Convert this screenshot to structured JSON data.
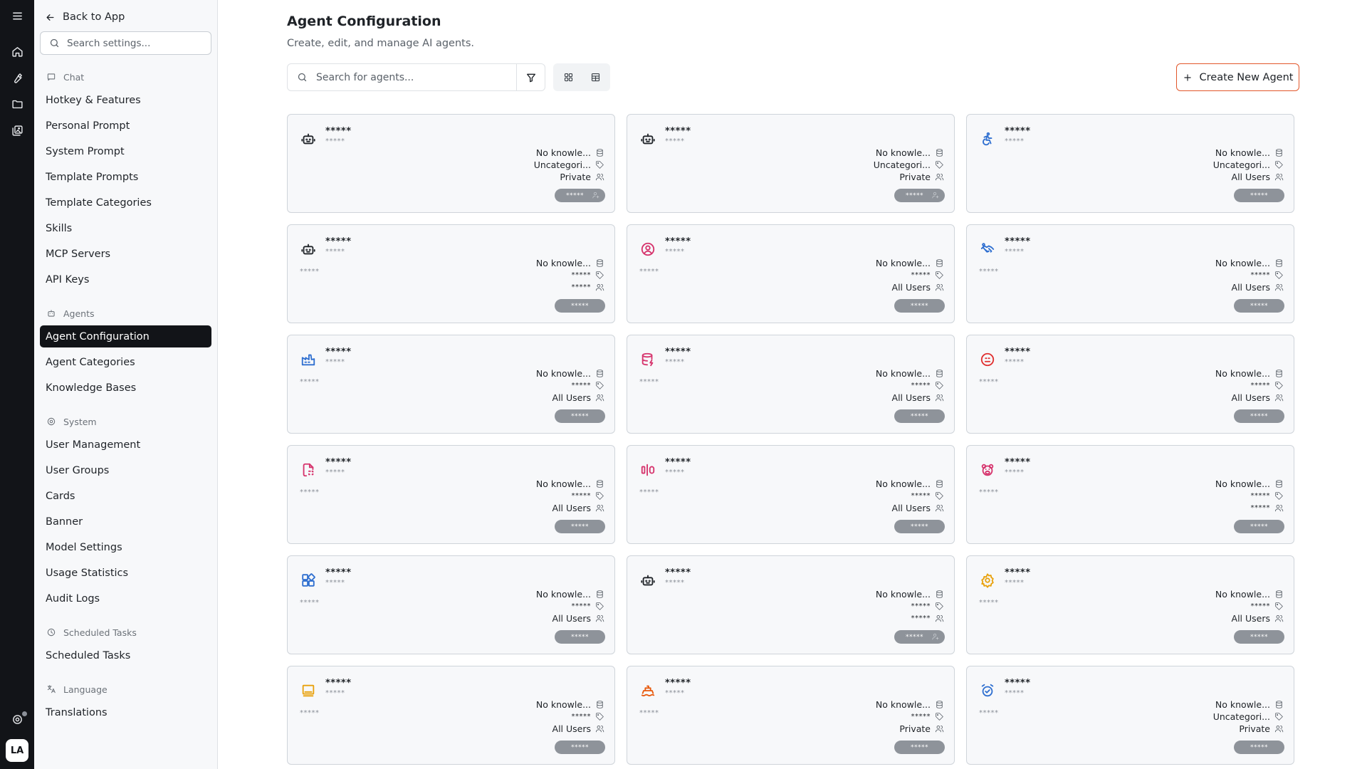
{
  "nav": {
    "back_label": "Back to App",
    "search_placeholder": "Search settings...",
    "sections": [
      {
        "title": "Chat",
        "icon": "chat-icon",
        "items": [
          "Hotkey & Features",
          "Personal Prompt",
          "System Prompt",
          "Template Prompts",
          "Template Categories",
          "Skills",
          "MCP Servers",
          "API Keys"
        ]
      },
      {
        "title": "Agents",
        "icon": "agents-icon",
        "items": [
          "Agent Configuration",
          "Agent Categories",
          "Knowledge Bases"
        ]
      },
      {
        "title": "System",
        "icon": "system-icon",
        "items": [
          "User Management",
          "User Groups",
          "Cards",
          "Banner",
          "Model Settings",
          "Usage Statistics",
          "Audit Logs"
        ]
      },
      {
        "title": "Scheduled Tasks",
        "icon": "clock-icon",
        "items": [
          "Scheduled Tasks"
        ]
      },
      {
        "title": "Language",
        "icon": "language-icon",
        "items": [
          "Translations"
        ]
      }
    ],
    "active_item": "Agent Configuration"
  },
  "rail": {
    "icons": [
      "menu-icon",
      "home-icon",
      "tool-icon",
      "folder-icon",
      "gallery-icon"
    ],
    "bottom_icon": "support-icon",
    "avatar_initials": "LA"
  },
  "header": {
    "title": "Agent Configuration",
    "subtitle": "Create, edit, and manage AI agents.",
    "search_placeholder": "Search for agents...",
    "create_label": "Create New Agent"
  },
  "colors": {
    "accent": "#e2572b",
    "active_nav": "#121418",
    "pill": "#8e939a"
  },
  "cards": [
    {
      "icon": "robot-icon",
      "icon_color": "#1f2328",
      "name": "*****",
      "sub": "*****",
      "desc": "",
      "knowledge": "No knowle...",
      "category": "Uncategori...",
      "access": "Private",
      "badge": "*****",
      "badge_user_icon": true
    },
    {
      "icon": "robot-icon",
      "icon_color": "#1f2328",
      "name": "*****",
      "sub": "*****",
      "desc": "",
      "knowledge": "No knowle...",
      "category": "Uncategori...",
      "access": "Private",
      "badge": "*****",
      "badge_user_icon": true
    },
    {
      "icon": "accessibility-icon",
      "icon_color": "#2f6fd0",
      "name": "*****",
      "sub": "*****",
      "desc": "",
      "knowledge": "No knowle...",
      "category": "Uncategori...",
      "access": "All Users",
      "badge": "*****",
      "badge_user_icon": false
    },
    {
      "icon": "robot-icon",
      "icon_color": "#1f2328",
      "name": "*****",
      "sub": "*****",
      "desc": "*****",
      "knowledge": "No knowle...",
      "category": "*****",
      "access": "*****",
      "badge": "*****",
      "badge_user_icon": false
    },
    {
      "icon": "user-circle-icon",
      "icon_color": "#d6336c",
      "name": "*****",
      "sub": "*****",
      "desc": "*****",
      "knowledge": "No knowle...",
      "category": "*****",
      "access": "All Users",
      "badge": "*****",
      "badge_user_icon": false
    },
    {
      "icon": "handshake-icon",
      "icon_color": "#2f6fd0",
      "name": "*****",
      "sub": "*****",
      "desc": "*****",
      "knowledge": "No knowle...",
      "category": "*****",
      "access": "All Users",
      "badge": "*****",
      "badge_user_icon": false
    },
    {
      "icon": "factory-icon",
      "icon_color": "#2f6fd0",
      "name": "*****",
      "sub": "*****",
      "desc": "*****",
      "knowledge": "No knowle...",
      "category": "*****",
      "access": "All Users",
      "badge": "*****",
      "badge_user_icon": false
    },
    {
      "icon": "database-bolt-icon",
      "icon_color": "#d6336c",
      "name": "*****",
      "sub": "*****",
      "desc": "*****",
      "knowledge": "No knowle...",
      "category": "*****",
      "access": "All Users",
      "badge": "*****",
      "badge_user_icon": false
    },
    {
      "icon": "face-neutral-icon",
      "icon_color": "#e03131",
      "name": "*****",
      "sub": "*****",
      "desc": "*****",
      "knowledge": "No knowle...",
      "category": "*****",
      "access": "All Users",
      "badge": "*****",
      "badge_user_icon": false
    },
    {
      "icon": "file-dashed-icon",
      "icon_color": "#d6336c",
      "name": "*****",
      "sub": "*****",
      "desc": "*****",
      "knowledge": "No knowle...",
      "category": "*****",
      "access": "All Users",
      "badge": "*****",
      "badge_user_icon": false
    },
    {
      "icon": "align-center-icon",
      "icon_color": "#d6336c",
      "name": "*****",
      "sub": "*****",
      "desc": "*****",
      "knowledge": "No knowle...",
      "category": "*****",
      "access": "All Users",
      "badge": "*****",
      "badge_user_icon": false
    },
    {
      "icon": "bear-icon",
      "icon_color": "#d6336c",
      "name": "*****",
      "sub": "*****",
      "desc": "*****",
      "knowledge": "No knowle...",
      "category": "*****",
      "access": "*****",
      "badge": "*****",
      "badge_user_icon": false
    },
    {
      "icon": "apps-icon",
      "icon_color": "#2f6fd0",
      "name": "*****",
      "sub": "*****",
      "desc": "*****",
      "knowledge": "No knowle...",
      "category": "*****",
      "access": "All Users",
      "badge": "*****",
      "badge_user_icon": false
    },
    {
      "icon": "robot-icon",
      "icon_color": "#1f2328",
      "name": "*****",
      "sub": "*****",
      "desc": "",
      "knowledge": "No knowle...",
      "category": "*****",
      "access": "*****",
      "badge": "*****",
      "badge_user_icon": true
    },
    {
      "icon": "gear-icon",
      "icon_color": "#e8a10c",
      "name": "*****",
      "sub": "*****",
      "desc": "*****",
      "knowledge": "No knowle...",
      "category": "*****",
      "access": "All Users",
      "badge": "*****",
      "badge_user_icon": false
    },
    {
      "icon": "slideshow-icon",
      "icon_color": "#e8a10c",
      "name": "*****",
      "sub": "*****",
      "desc": "*****",
      "knowledge": "No knowle...",
      "category": "*****",
      "access": "All Users",
      "badge": "*****",
      "badge_user_icon": false
    },
    {
      "icon": "ship-icon",
      "icon_color": "#e8590c",
      "name": "*****",
      "sub": "*****",
      "desc": "*****",
      "knowledge": "No knowle...",
      "category": "*****",
      "access": "Private",
      "badge": "*****",
      "badge_user_icon": false
    },
    {
      "icon": "alarm-icon",
      "icon_color": "#2f6fd0",
      "name": "*****",
      "sub": "*****",
      "desc": "*****",
      "knowledge": "No knowle...",
      "category": "Uncategori...",
      "access": "Private",
      "badge": "*****",
      "badge_user_icon": false
    }
  ]
}
